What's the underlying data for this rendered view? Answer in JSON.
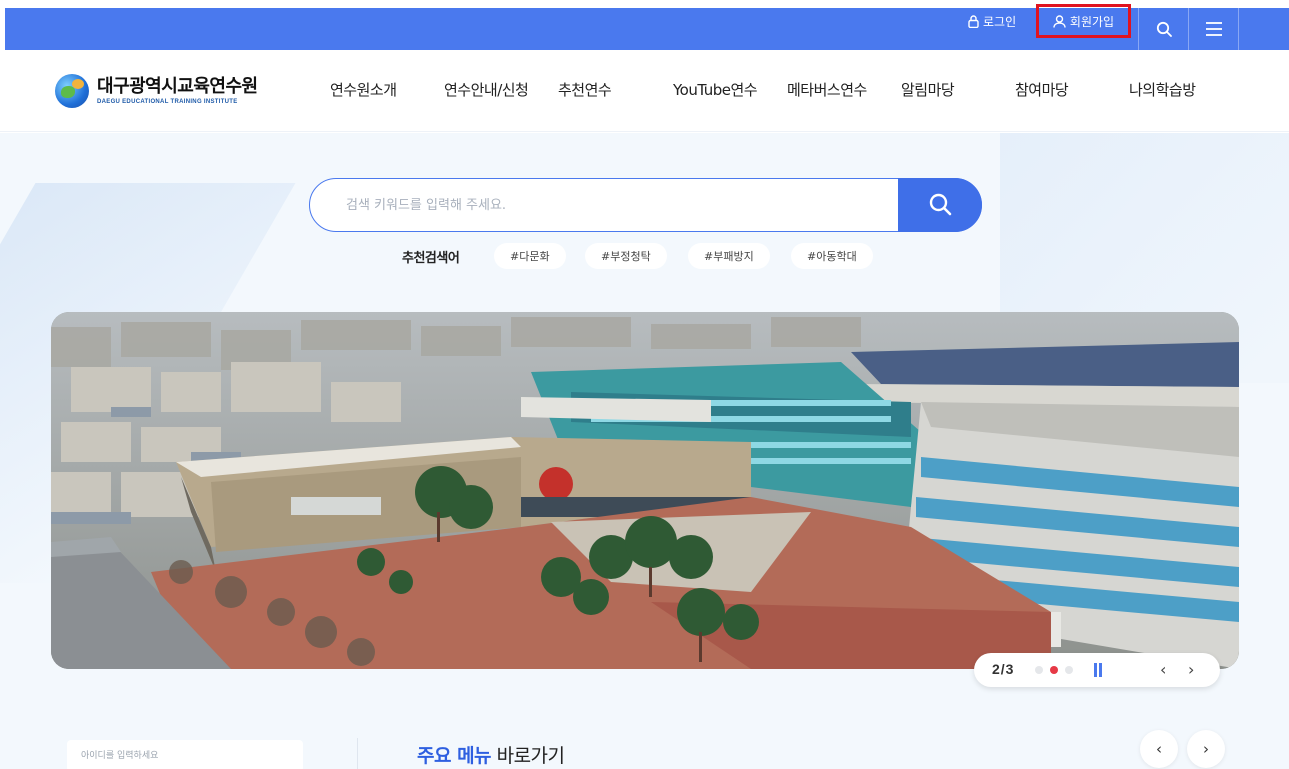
{
  "topbar": {
    "login_label": "로그인",
    "join_label": "회원가입",
    "icons": [
      "lock-icon",
      "user-icon",
      "search-icon",
      "menu-icon"
    ]
  },
  "header": {
    "logo_kr": "대구광역시교육연수원",
    "logo_en": "DAEGU EDUCATIONAL TRAINING INSTITUTE",
    "nav": [
      "연수원소개",
      "연수안내/신청",
      "추천연수",
      "YouTube연수",
      "메타버스연수",
      "알림마당",
      "참여마당",
      "나의학습방"
    ]
  },
  "search": {
    "placeholder": "검색 키워드를 입력해 주세요.",
    "recommended_label": "추천검색어",
    "tags": [
      "#다문화",
      "#부정청탁",
      "#부패방지",
      "#아동학대"
    ]
  },
  "slider": {
    "counter": "2/3",
    "current": 2,
    "total": 3
  },
  "bottom": {
    "login_placeholder": "아이디를 입력하세요",
    "main_menu_highlight": "주요 메뉴",
    "main_menu_rest": " 바로가기"
  },
  "colors": {
    "topbar": "#4a79ee",
    "accent": "#3f6fe8",
    "highlight_box": "#e0131f",
    "active_dot": "#e63946"
  }
}
